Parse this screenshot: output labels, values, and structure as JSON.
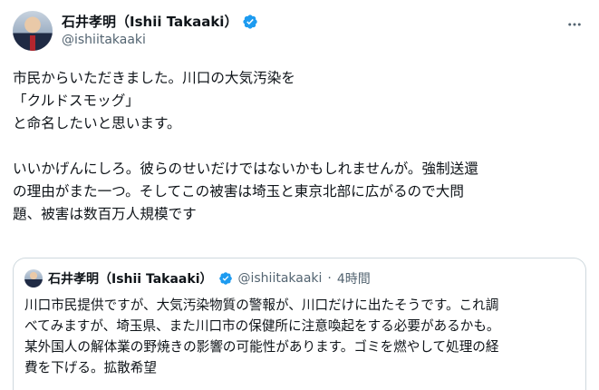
{
  "tweet": {
    "author": {
      "display_name": "石井孝明（Ishii Takaaki）",
      "handle": "@ishiitakaaki",
      "verified": true,
      "avatar_icon": "avatar-photo"
    },
    "more_icon": "more-options-icon",
    "lines": [
      "市民からいただきました。川口の大気汚染を",
      "「クルドスモッグ」",
      "と命名したいと思います。",
      "",
      "いいかげんにしろ。彼らのせいだけではないかもしれませんが。強制送還",
      "の理由がまた一つ。そしてこの被害は埼玉と東京北部に広がるので大問",
      "題、被害は数百万人規模です"
    ]
  },
  "quote": {
    "author": {
      "display_name": "石井孝明（Ishii Takaaki）",
      "handle": "@ishiitakaaki",
      "separator": "·",
      "time": "4時間",
      "verified": true
    },
    "lines": [
      "川口市民提供ですが、大気汚染物質の警報が、川口だけに出たそうです。これ調",
      "べてみますが、埼玉県、また川口市の保健所に注意喚起をする必要があるかも。",
      "某外国人の解体業の野焼きの影響の可能性があります。ゴミを燃やして処理の経",
      "費を下げる。拡散希望"
    ]
  },
  "colors": {
    "text": "#0f1419",
    "secondary": "#536471",
    "verified_badge": "#1d9bf0",
    "border": "#cfd9de"
  }
}
